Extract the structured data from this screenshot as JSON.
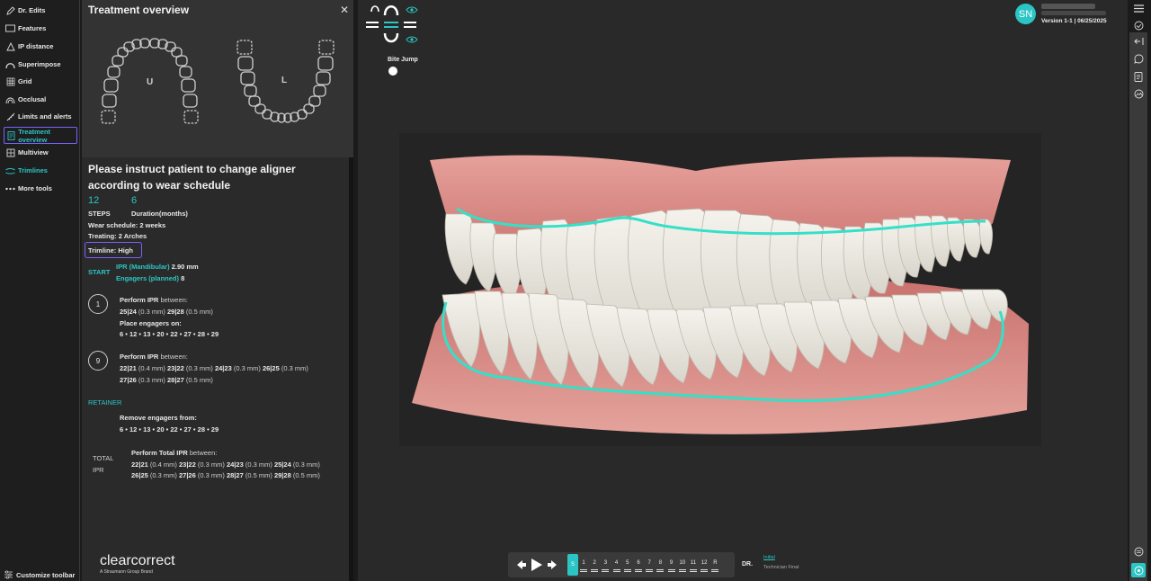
{
  "toolbar": {
    "items": [
      {
        "label": "Dr. Edits",
        "icon": "pencil-icon"
      },
      {
        "label": "Features",
        "icon": "rectangle-icon"
      },
      {
        "label": "IP distance",
        "icon": "triangle-icon"
      },
      {
        "label": "Superimpose",
        "icon": "arch-icon"
      },
      {
        "label": "Grid",
        "icon": "grid-icon"
      },
      {
        "label": "Occlusal",
        "icon": "occlusal-icon"
      },
      {
        "label": "Limits and alerts",
        "icon": "ruler-icon"
      },
      {
        "label": "Treatment overview",
        "icon": "document-icon"
      },
      {
        "label": "Multiview",
        "icon": "multiview-icon"
      },
      {
        "label": "Trimlines",
        "icon": "trimlines-icon"
      },
      {
        "label": "More tools",
        "icon": "dots-icon"
      }
    ],
    "customize_label": "Customize toolbar"
  },
  "panel": {
    "title": "Treatment overview",
    "upper_label": "U",
    "lower_label": "L",
    "instruction": "Please instruct patient to change aligner according to wear schedule",
    "steps_value": "12",
    "steps_label": "STEPS",
    "duration_value": "6",
    "duration_label": "Duration(months)",
    "wear_schedule": "Wear schedule: 2 weeks",
    "treating": "Treating: 2 Arches",
    "trimline": "Trimline: High",
    "start_label": "START",
    "ipr_label": "IPR (Mandibular)",
    "ipr_value": "2.90 mm",
    "engagers_label": "Engagers (planned)",
    "engagers_value": "8",
    "step1": {
      "num": "1",
      "perform": "Perform IPR",
      "between": "between:",
      "ipr_line": [
        {
          "pair": "25|24",
          "mm": "(0.3 mm)"
        },
        {
          "pair": "29|28",
          "mm": "(0.5 mm)"
        }
      ],
      "place": "Place engagers on:",
      "engagers": "6 • 12 • 13 • 20 • 22 • 27 • 28 • 29"
    },
    "step9": {
      "num": "9",
      "perform": "Perform IPR",
      "between": "between:",
      "line1": [
        {
          "pair": "22|21",
          "mm": "(0.4 mm)"
        },
        {
          "pair": "23|22",
          "mm": "(0.3 mm)"
        },
        {
          "pair": "24|23",
          "mm": "(0.3 mm)"
        },
        {
          "pair": "26|25",
          "mm": "(0.3 mm)"
        }
      ],
      "line2": [
        {
          "pair": "27|26",
          "mm": "(0.3 mm)"
        },
        {
          "pair": "28|27",
          "mm": "(0.5 mm)"
        }
      ]
    },
    "retainer_label": "RETAINER",
    "remove_label": "Remove engagers from:",
    "remove_list": "6 • 12 • 13 • 20 • 22 • 27 • 28 • 29",
    "total_label_1": "TOTAL",
    "total_label_2": "IPR",
    "total_perform": "Perform Total IPR",
    "total_between": "between:",
    "total_line1": [
      {
        "pair": "22|21",
        "mm": "(0.4 mm)"
      },
      {
        "pair": "23|22",
        "mm": "(0.3 mm)"
      },
      {
        "pair": "24|23",
        "mm": "(0.3 mm)"
      },
      {
        "pair": "25|24",
        "mm": "(0.3 mm)"
      }
    ],
    "total_line2": [
      {
        "pair": "26|25",
        "mm": "(0.3 mm)"
      },
      {
        "pair": "27|26",
        "mm": "(0.3 mm)"
      },
      {
        "pair": "28|27",
        "mm": "(0.5 mm)"
      },
      {
        "pair": "29|28",
        "mm": "(0.5 mm)"
      }
    ],
    "logo": "clearcorrect",
    "logo_sub": "A Straumann Group Brand"
  },
  "viewer": {
    "bite_jump_label": "Bite Jump",
    "avatar_initials": "SN",
    "version": "Version 1-1 | 06/25/2025",
    "timeline": {
      "current": "S",
      "steps": [
        "1",
        "2",
        "3",
        "4",
        "5",
        "6",
        "7",
        "8",
        "9",
        "10",
        "11",
        "12",
        "R"
      ],
      "dr_label": "DR.",
      "initial_label": "Initial",
      "technician_final_label": "Technician Final"
    },
    "colors": {
      "accent": "#2cc5c5",
      "gum": "#d98a85",
      "highlight": "#7b61ff"
    }
  }
}
